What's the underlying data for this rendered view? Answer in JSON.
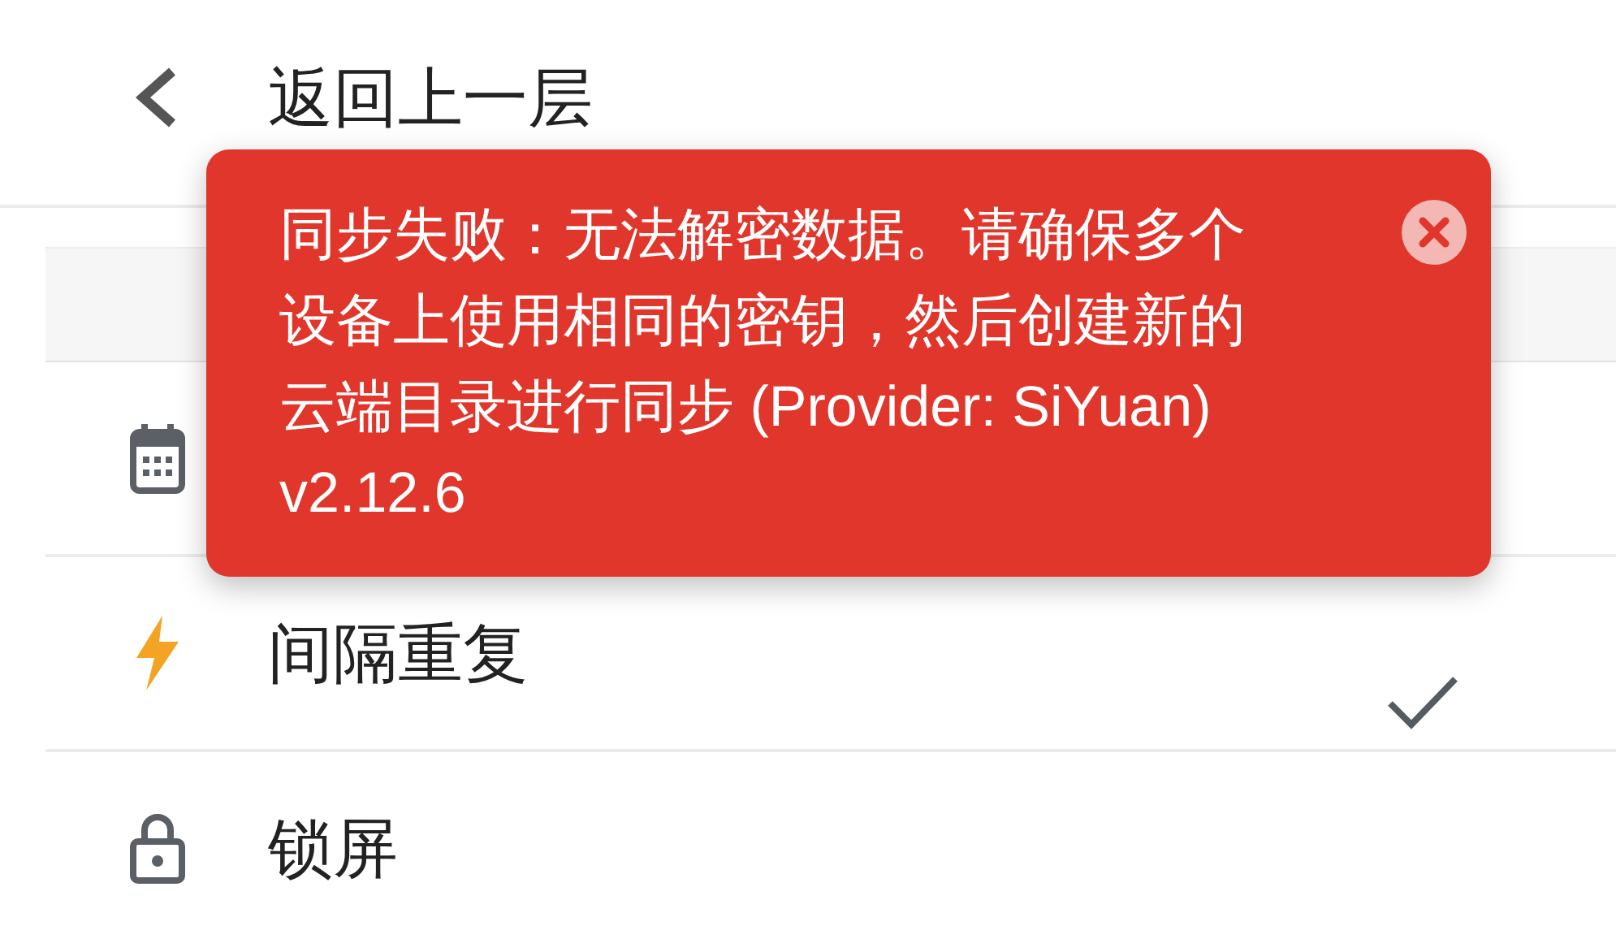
{
  "header": {
    "title": "返回上一层"
  },
  "items": [
    {
      "kind": "calendar"
    },
    {
      "kind": "bolt",
      "label": "间隔重复",
      "checked": true
    },
    {
      "kind": "lock",
      "label": "锁屏",
      "checked": false
    }
  ],
  "toast": {
    "message": "同步失败：无法解密数据。请确保多个设备上使用相同的密钥，然后创建新的云端目录进行同步 (Provider: SiYuan) v2.12.6"
  }
}
